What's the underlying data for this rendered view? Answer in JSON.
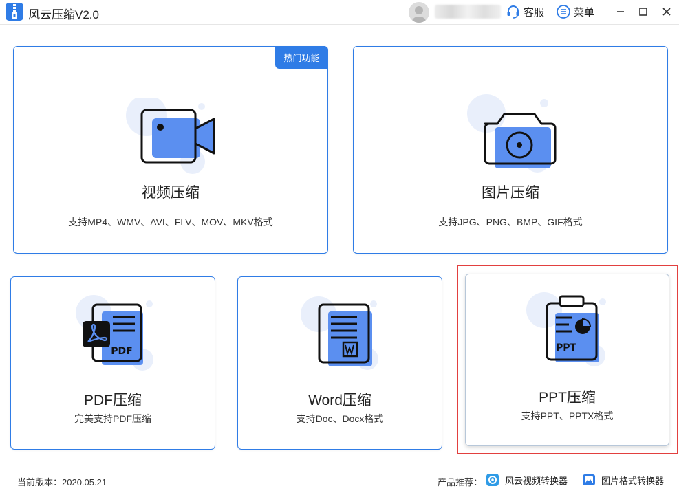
{
  "window": {
    "title": "风云压缩V2.0",
    "service_label": "客服",
    "menu_label": "菜单"
  },
  "cards": {
    "video": {
      "tag": "热门功能",
      "title": "视频压缩",
      "desc": "支持MP4、WMV、AVI、FLV、MOV、MKV格式"
    },
    "image": {
      "title": "图片压缩",
      "desc": "支持JPG、PNG、BMP、GIF格式"
    },
    "pdf": {
      "title": "PDF压缩",
      "desc": "完美支持PDF压缩",
      "icon_text": "PDF"
    },
    "word": {
      "title": "Word压缩",
      "desc": "支持Doc、Docx格式"
    },
    "ppt": {
      "title": "PPT压缩",
      "desc": "支持PPT、PPTX格式",
      "icon_text": "PPT"
    }
  },
  "footer": {
    "version": "当前版本：2020.05.21",
    "recommend_label": "产品推荐：",
    "links": [
      "风云视频转换器",
      "图片格式转换器"
    ]
  },
  "colors": {
    "accent": "#2f7ce6",
    "icon_fill": "#5b8ff0",
    "icon_bg": "#e9effb",
    "highlight": "#e2403f"
  }
}
